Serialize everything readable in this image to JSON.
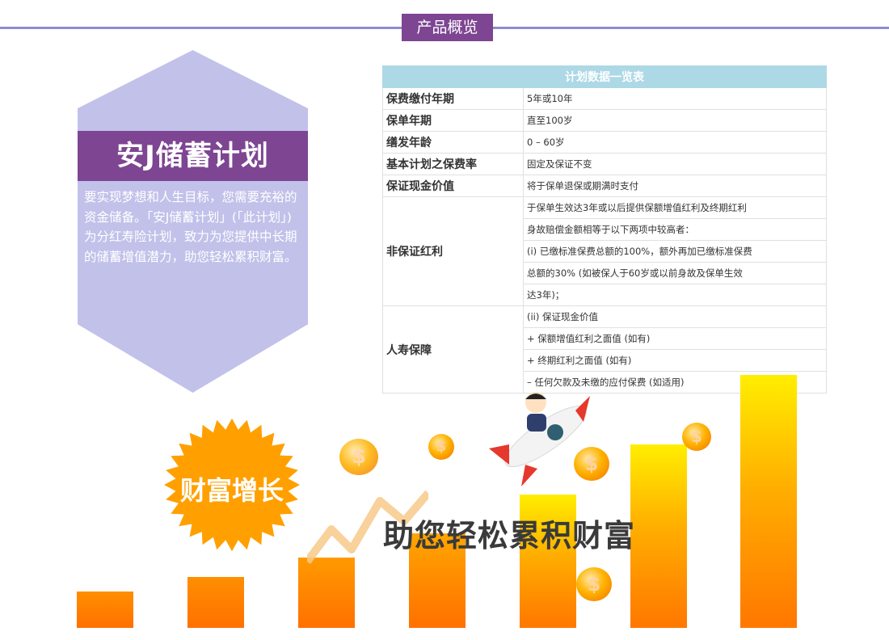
{
  "header": {
    "badge": "产品概览"
  },
  "plan": {
    "title": "安J储蓄计划",
    "description": "要实现梦想和人生目标，您需要充裕的资金储备。「安J储蓄计划」(「此计划」)为分红寿险计划，致力为您提供中长期的储蓄增值潜力，助您轻松累积财富。"
  },
  "table": {
    "caption": "计划数据一览表",
    "rows": [
      {
        "label": "保费缴付年期",
        "value": "5年或10年"
      },
      {
        "label": "保单年期",
        "value": "直至100岁"
      },
      {
        "label": "缮发年龄",
        "value": "0 – 60岁"
      },
      {
        "label": "基本计划之保费率",
        "value": "固定及保证不变"
      },
      {
        "label": "保证现金价值",
        "value": "将于保单退保或期满时支付"
      }
    ],
    "dividend": {
      "label": "非保证红利",
      "lines": [
        "于保单生效达3年或以后提供保额增值红利及终期红利",
        "身故赔偿金额相等于以下两项中较高者：",
        "(i)  已缴标准保费总额的100%，额外再加已缴标准保费",
        "总额的30%      (如被保人于60岁或以前身故及保单生效",
        "达3年)；"
      ]
    },
    "life": {
      "label": "人寿保障",
      "lines": [
        "(ii) 保证现金价值",
        "+ 保额增值红利之面值 (如有)",
        "+ 终期红利之面值 (如有)",
        "– 任何欠款及未缴的应付保费 (如适用)"
      ]
    }
  },
  "graphic": {
    "burst_text": "财富增长",
    "slogan": "助您轻松累积财富",
    "coin_symbol": "$",
    "colors": {
      "purple": "#7d4592",
      "lavender": "#c1c1ea",
      "orange": "#ff7700",
      "yellow": "#ffee00",
      "table_header": "#add8e6"
    }
  }
}
